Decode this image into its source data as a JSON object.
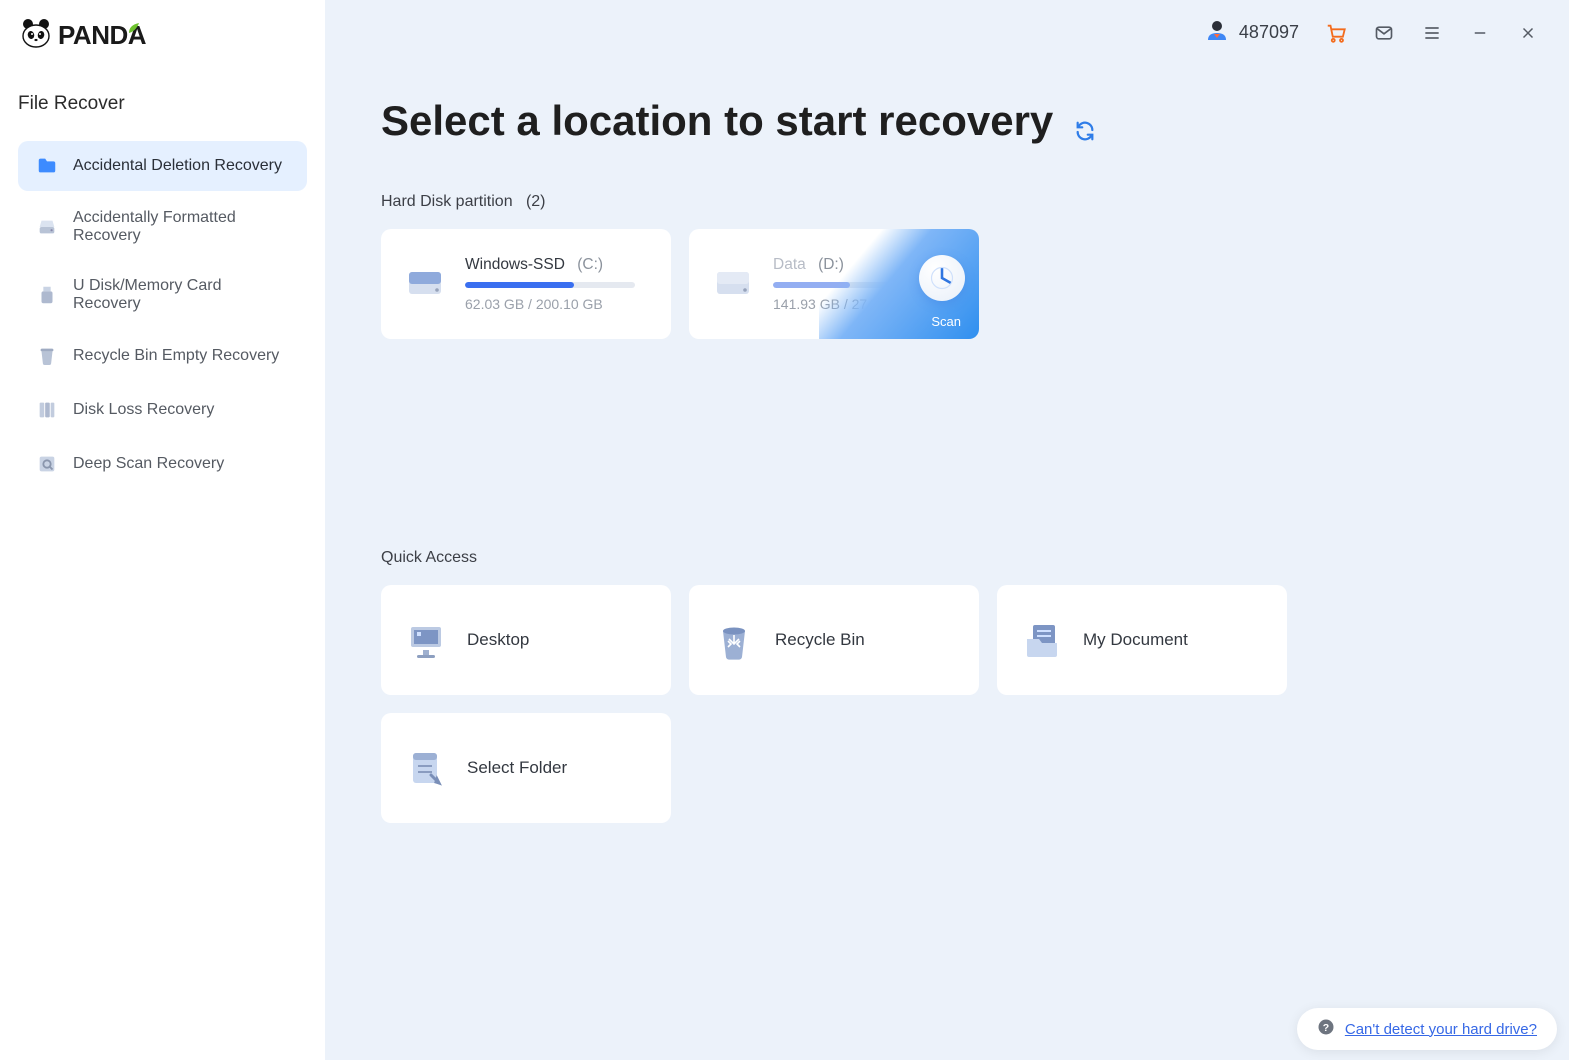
{
  "app": {
    "brand": "PANDA"
  },
  "sidebar": {
    "title": "File Recover",
    "items": [
      {
        "label": "Accidental Deletion Recovery",
        "icon": "folder-icon",
        "active": true
      },
      {
        "label": "Accidentally Formatted Recovery",
        "icon": "drive-icon",
        "active": false
      },
      {
        "label": "U Disk/Memory Card Recovery",
        "icon": "usb-icon",
        "active": false
      },
      {
        "label": "Recycle Bin Empty Recovery",
        "icon": "trash-icon",
        "active": false
      },
      {
        "label": "Disk Loss Recovery",
        "icon": "disk-stack-icon",
        "active": false
      },
      {
        "label": "Deep Scan Recovery",
        "icon": "scan-icon",
        "active": false
      }
    ]
  },
  "header": {
    "user_id": "487097"
  },
  "main": {
    "title": "Select a location to start recovery",
    "partitions_label": "Hard Disk partition",
    "partitions_count": "(2)",
    "partitions": [
      {
        "name": "Windows-SSD",
        "letter": "(C:)",
        "used": "62.03 GB",
        "total": "200.10 GB",
        "fill_pct": 64,
        "hover": false
      },
      {
        "name": "Data",
        "letter": "(D:)",
        "used": "141.93 GB",
        "total": "274.62 GB",
        "fill_pct": 45,
        "hover": true
      }
    ],
    "scan_label": "Scan",
    "quick_access_label": "Quick Access",
    "quick_access": [
      {
        "label": "Desktop",
        "icon": "desktop-icon"
      },
      {
        "label": "Recycle Bin",
        "icon": "recycle-bin-icon"
      },
      {
        "label": "My Document",
        "icon": "document-folder-icon"
      },
      {
        "label": "Select Folder",
        "icon": "select-folder-icon"
      }
    ]
  },
  "help": {
    "text": "Can't detect your hard drive?"
  }
}
